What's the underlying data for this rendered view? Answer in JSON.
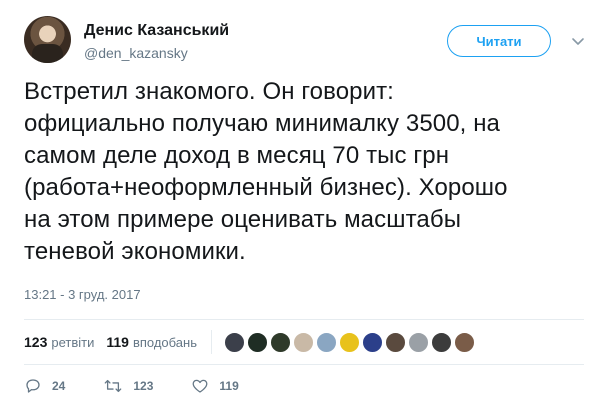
{
  "author": {
    "name": "Денис Казанський",
    "handle": "@den_kazansky"
  },
  "follow_button": {
    "label": "Читати"
  },
  "tweet": {
    "text": "Встретил знакомого. Он говорит:\nофициально получаю минималку 3500, на\nсамом деле доход в месяц 70 тыс грн\n(работа+неоформленный бизнес). Хорошо\nна этом примере оценивать масштабы\nтеневой экономики.",
    "timestamp": "13:21 - 3 груд. 2017"
  },
  "stats": {
    "retweets_count": "123",
    "retweets_label": "ретвіти",
    "likes_count": "119",
    "likes_label": "вподобань"
  },
  "liker_avatars": [
    {
      "name": "liker-avatar-1",
      "color": "#3b3f4a"
    },
    {
      "name": "liker-avatar-2",
      "color": "#1f2d24"
    },
    {
      "name": "liker-avatar-3",
      "color": "#2f3a2a"
    },
    {
      "name": "liker-avatar-4",
      "color": "#c9b9a6"
    },
    {
      "name": "liker-avatar-5",
      "color": "#8aa6c2"
    },
    {
      "name": "liker-avatar-6",
      "color": "#e8c21c"
    },
    {
      "name": "liker-avatar-7",
      "color": "#2b3f8a"
    },
    {
      "name": "liker-avatar-8",
      "color": "#5a4a3e"
    },
    {
      "name": "liker-avatar-9",
      "color": "#9aa0a6"
    },
    {
      "name": "liker-avatar-10",
      "color": "#3c3c3c"
    },
    {
      "name": "liker-avatar-11",
      "color": "#7a5c48"
    }
  ],
  "actions": {
    "replies": "24",
    "retweets": "123",
    "likes": "119"
  },
  "icons": {
    "more": "chevron-down-icon",
    "reply": "reply-icon",
    "retweet": "retweet-icon",
    "like": "heart-icon"
  },
  "colors": {
    "accent": "#1da1f2",
    "muted": "#657786",
    "text": "#14171a"
  }
}
